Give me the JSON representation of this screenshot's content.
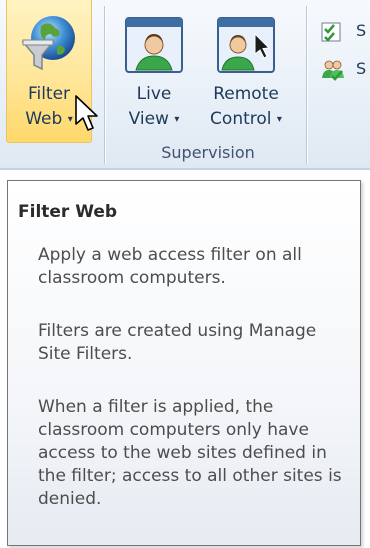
{
  "ribbon": {
    "group_label": "Supervision",
    "buttons": [
      {
        "label_line1": "Filter",
        "label_line2": "Web",
        "dropdown": true,
        "state": "hovered",
        "icon": "globe-funnel-icon"
      },
      {
        "label_line1": "Live",
        "label_line2": "View",
        "dropdown": true,
        "icon": "monitor-user-icon"
      },
      {
        "label_line1": "Remote",
        "label_line2": "Control",
        "dropdown": true,
        "icon": "monitor-user-cursor-icon"
      }
    ],
    "small_buttons": [
      {
        "label": "S",
        "icon": "checklist-icon"
      },
      {
        "label": "S",
        "icon": "users-check-icon"
      }
    ],
    "caret": "▾"
  },
  "tooltip": {
    "title": "Filter Web",
    "paragraphs": [
      "Apply a web access filter on all classroom computers.",
      "Filters are created using Manage Site Filters.",
      "When a filter is applied, the classroom computers only have access to the web sites defined in the filter; access to all other sites is denied."
    ]
  },
  "colors": {
    "hover_gradient_top": "#fff3c2",
    "hover_gradient_bottom": "#ffd86a",
    "ribbon_text": "#1e395b",
    "tooltip_border": "#767676"
  }
}
